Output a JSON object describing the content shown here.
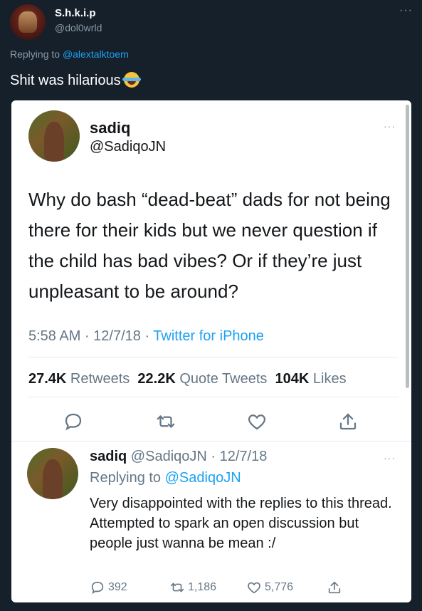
{
  "outer": {
    "name": "S.h.k.i.p",
    "handle": "@dol0wrld",
    "more": "···",
    "replying_prefix": "Replying to ",
    "replying_to": "@alextalktoem",
    "text": "Shit was hilarious",
    "emoji": "face-with-tears-of-joy"
  },
  "quoted": {
    "name": "sadiq",
    "handle": "@SadiqoJN",
    "more": "···",
    "text": "Why do bash “dead-beat” dads for not being there for their kids but we never question if the child has bad vibes? Or if they’re just unpleasant to be around?",
    "time": "5:58 AM · 12/7/18 · ",
    "source": "Twitter for iPhone",
    "retweets": "27.4K",
    "retweets_label": " Retweets  ",
    "quotes": "22.2K",
    "quotes_label": " Quote Tweets  ",
    "likes": "104K",
    "likes_label": " Likes"
  },
  "reply": {
    "name": "sadiq",
    "handle_date": " @SadiqoJN · 12/7/18",
    "replying_prefix": "Replying to ",
    "replying_to": "@SadiqoJN",
    "text": "Very disappointed with the replies to this thread. Attempted to spark an open discussion but people just wanna be mean :/",
    "reply_count": "392",
    "retweet_count": "1,186",
    "like_count": "5,776"
  },
  "colors": {
    "background": "#15202b",
    "link": "#1da1f2",
    "muted": "#657786",
    "card": "#ffffff"
  }
}
